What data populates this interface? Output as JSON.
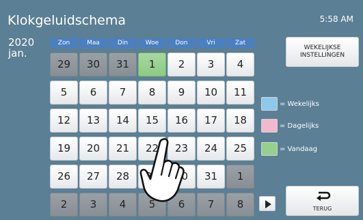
{
  "header": {
    "title": "Klokgeluidschema",
    "time": "5:58 AM"
  },
  "calendar": {
    "year": "2020",
    "month": "jan.",
    "days": [
      "Zon",
      "Maa",
      "Din",
      "Woe",
      "Don",
      "Vri",
      "Zat"
    ],
    "weeks": [
      [
        {
          "d": "29",
          "t": "gray"
        },
        {
          "d": "30",
          "t": "gray"
        },
        {
          "d": "31",
          "t": "gray"
        },
        {
          "d": "1",
          "t": "today"
        },
        {
          "d": "2",
          "t": "white"
        },
        {
          "d": "3",
          "t": "white"
        },
        {
          "d": "4",
          "t": "white"
        }
      ],
      [
        {
          "d": "5",
          "t": "white"
        },
        {
          "d": "6",
          "t": "white"
        },
        {
          "d": "7",
          "t": "white"
        },
        {
          "d": "8",
          "t": "white"
        },
        {
          "d": "9",
          "t": "white"
        },
        {
          "d": "10",
          "t": "white"
        },
        {
          "d": "11",
          "t": "white"
        }
      ],
      [
        {
          "d": "12",
          "t": "white"
        },
        {
          "d": "13",
          "t": "white"
        },
        {
          "d": "14",
          "t": "white"
        },
        {
          "d": "15",
          "t": "white"
        },
        {
          "d": "16",
          "t": "white"
        },
        {
          "d": "17",
          "t": "white"
        },
        {
          "d": "18",
          "t": "white"
        }
      ],
      [
        {
          "d": "19",
          "t": "white"
        },
        {
          "d": "20",
          "t": "white"
        },
        {
          "d": "21",
          "t": "white"
        },
        {
          "d": "22",
          "t": "white"
        },
        {
          "d": "23",
          "t": "white"
        },
        {
          "d": "24",
          "t": "white"
        },
        {
          "d": "25",
          "t": "white"
        }
      ],
      [
        {
          "d": "26",
          "t": "white"
        },
        {
          "d": "27",
          "t": "white"
        },
        {
          "d": "28",
          "t": "white"
        },
        {
          "d": "29",
          "t": "white"
        },
        {
          "d": "30",
          "t": "white"
        },
        {
          "d": "31",
          "t": "white"
        },
        {
          "d": "1",
          "t": "gray"
        }
      ],
      [
        {
          "d": "2",
          "t": "gray"
        },
        {
          "d": "3",
          "t": "gray"
        },
        {
          "d": "4",
          "t": "gray"
        },
        {
          "d": "5",
          "t": "gray"
        },
        {
          "d": "6",
          "t": "gray"
        },
        {
          "d": "7",
          "t": "gray"
        },
        {
          "d": "8",
          "t": "gray"
        }
      ]
    ]
  },
  "buttons": {
    "weekly_line1": "WEKELIJKSE",
    "weekly_line2": "INSTELLINGEN",
    "back": "TERUG"
  },
  "legend": [
    {
      "label": "= Wekelijks",
      "color": "#8ec8ec"
    },
    {
      "label": "= Dagelijks",
      "color": "#f4b8cc"
    },
    {
      "label": "= Vandaag",
      "color": "#98cf8c"
    }
  ],
  "icons": {
    "next": "play-triangle-icon",
    "back": "return-arrow-icon",
    "pointer": "hand-pointer-icon"
  }
}
